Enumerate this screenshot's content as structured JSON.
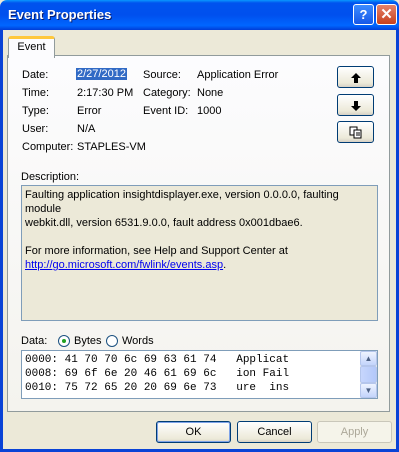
{
  "window": {
    "title": "Event Properties",
    "help_button": "?",
    "close_button": "✕"
  },
  "tabs": [
    {
      "label": "Event"
    }
  ],
  "event": {
    "date_label": "Date:",
    "date": "2/27/2012",
    "time_label": "Time:",
    "time": "2:17:30 PM",
    "type_label": "Type:",
    "type": "Error",
    "user_label": "User:",
    "user": "N/A",
    "computer_label": "Computer:",
    "computer": "STAPLES-VM",
    "source_label": "Source:",
    "source": "Application Error",
    "category_label": "Category:",
    "category": "None",
    "event_id_label": "Event ID:",
    "event_id": "1000"
  },
  "side_buttons": {
    "up_icon": "arrow-up",
    "down_icon": "arrow-down",
    "copy_icon": "copy"
  },
  "description": {
    "label": "Description:",
    "line1": "Faulting application insightdisplayer.exe, version 0.0.0.0, faulting module",
    "line2": "webkit.dll, version 6531.9.0.0, fault address 0x001dbae6.",
    "line3": "For more information, see Help and Support Center at",
    "link": "http://go.microsoft.com/fwlink/events.asp",
    "link_suffix": "."
  },
  "data": {
    "label": "Data:",
    "options": [
      {
        "label": "Bytes",
        "selected": true
      },
      {
        "label": "Words",
        "selected": false
      }
    ],
    "lines": [
      "0000: 41 70 70 6c 69 63 61 74   Applicat",
      "0008: 69 6f 6e 20 46 61 69 6c   ion Fail",
      "0010: 75 72 65 20 20 69 6e 73   ure  ins"
    ]
  },
  "buttons": {
    "ok": "OK",
    "cancel": "Cancel",
    "apply": "Apply"
  }
}
